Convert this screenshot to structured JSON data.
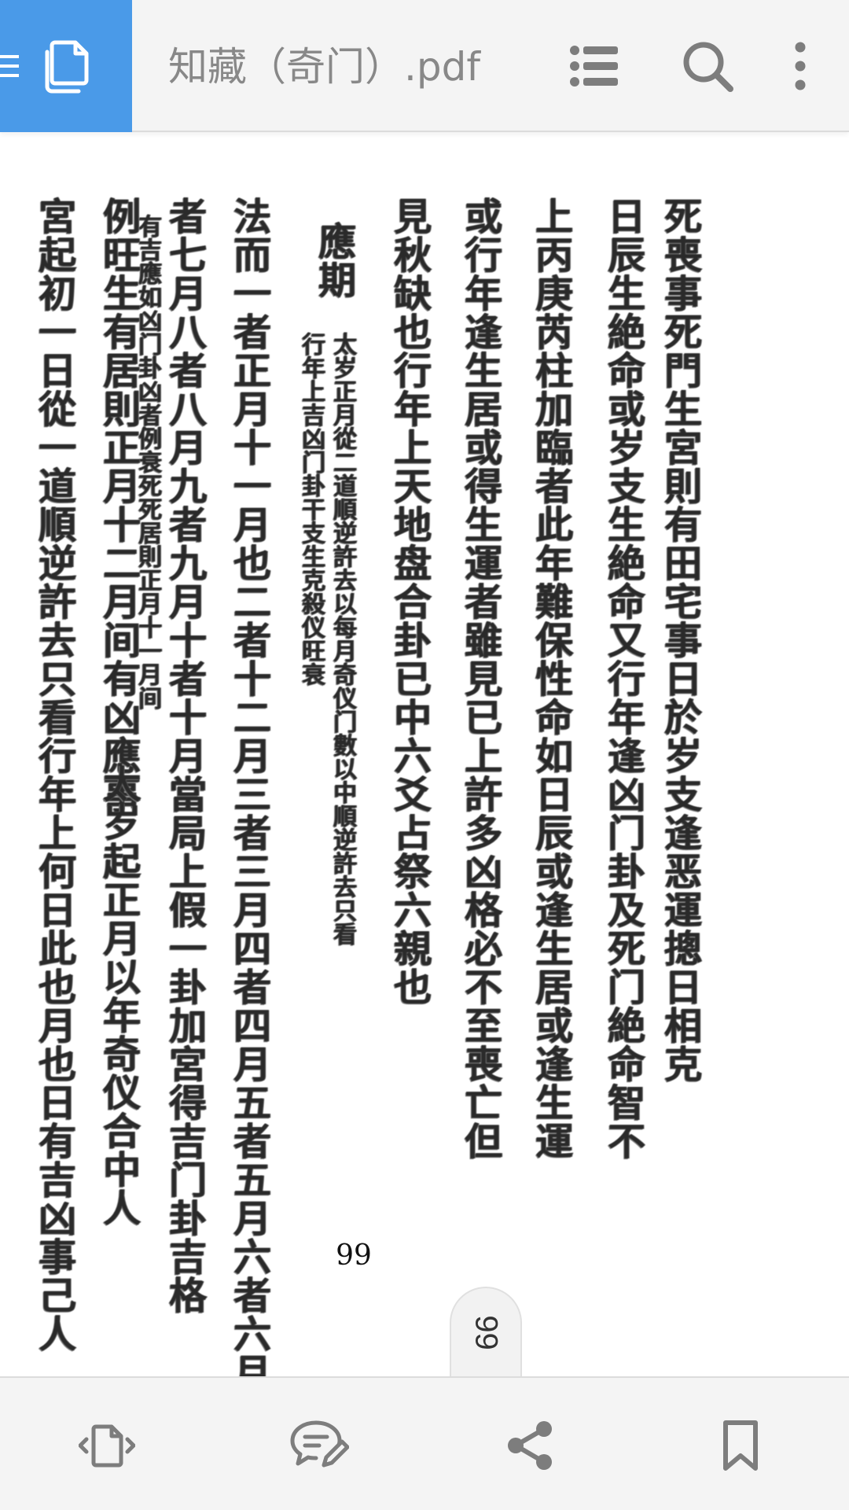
{
  "app": {
    "title": "知藏（奇门）.pdf"
  },
  "colors": {
    "accent": "#4a9ae8",
    "icon": "#7d7d7d",
    "bar_bg": "#f4f4f4"
  },
  "toolbar": {
    "nav_icon": "menu-icon",
    "copy_icon": "copy-icon",
    "actions": [
      {
        "name": "outline-button",
        "icon": "list-icon"
      },
      {
        "name": "search-button",
        "icon": "search-icon"
      },
      {
        "name": "more-button",
        "icon": "more-vertical-icon"
      }
    ]
  },
  "document": {
    "page_number": "99",
    "page_indicator": "99",
    "columns": [
      "死喪事死門生宮則有田宅事日於岁支逢恶運摠日相克",
      "日辰生絶命或岁支生絶命又行年逢凶门卦及死门絶命智不",
      "上丙庚芮柱加臨者此年難保性命如日辰或逢生居或逢生運",
      "或行年逢生居或得生運者雖見已上許多凶格必不至喪亡但",
      "見秋缺也行年上天地盘合卦已中六爻占祭六親也",
      "應期",
      "太岁正月從二道順逆許去以每月奇仪门數以中順逆許去只看",
      "行年上吉凶门卦干支生克殺仪旺衰",
      "法而一者正月十一月也二者十二月三者三月四者四月五者五月六者六月七",
      "者七月八者八月九者九月十者十月當局上假一卦加宮得吉门卦吉格",
      "有吉應如凶门卦凶者例衰死死居則正月十一月间",
      "例旺生有居則正月十二月间有凶應事",
      "太岁起正月以年奇仪合中人",
      "宮起初一日從一道順逆許去只看行年上何日此也月也日有吉凶事己人"
    ]
  },
  "bottom_toolbar": {
    "items": [
      {
        "name": "page-navigate-button",
        "icon": "page-navigate-icon"
      },
      {
        "name": "annotate-button",
        "icon": "comment-edit-icon"
      },
      {
        "name": "share-button",
        "icon": "share-icon"
      },
      {
        "name": "bookmark-button",
        "icon": "bookmark-icon"
      }
    ]
  }
}
